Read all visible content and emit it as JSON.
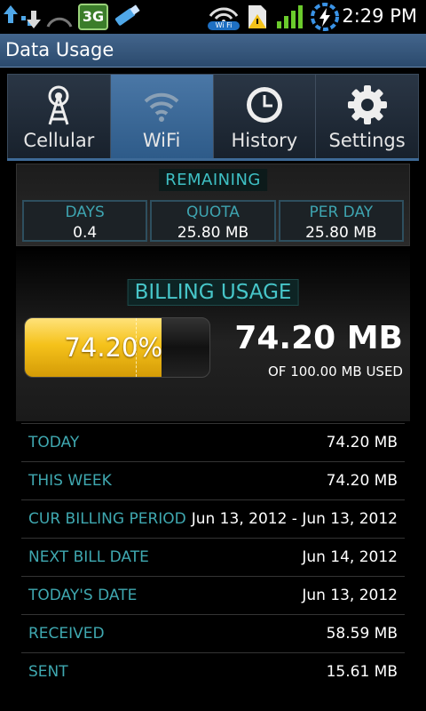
{
  "status_bar": {
    "time": "2:29 PM",
    "icons": [
      "upload-download-icon",
      "signal-arc-icon",
      "3g-badge-icon",
      "usb-icon",
      "wifi-icon",
      "sim-warning-icon",
      "cell-signal-bars-icon",
      "power-icon"
    ],
    "badge_3g": "3G",
    "wifi_label": "Wi Fi"
  },
  "header": {
    "title": "Data Usage"
  },
  "tabs": [
    {
      "label": "Cellular",
      "icon": "antenna-icon",
      "active": false
    },
    {
      "label": "WiFi",
      "icon": "wifi-icon",
      "active": true
    },
    {
      "label": "History",
      "icon": "clock-icon",
      "active": false
    },
    {
      "label": "Settings",
      "icon": "gear-icon",
      "active": false
    }
  ],
  "remaining": {
    "header": "REMAINING",
    "cells": [
      {
        "label": "DAYS",
        "value": "0.4"
      },
      {
        "label": "QUOTA",
        "value": "25.80 MB"
      },
      {
        "label": "PER DAY",
        "value": "25.80 MB"
      }
    ]
  },
  "billing": {
    "header": "BILLING USAGE",
    "percent_text": "74.20%",
    "percent_value": 0.742,
    "used_big": "74.20 MB",
    "used_small": "OF 100.00 MB USED"
  },
  "stats": [
    {
      "label": "TODAY",
      "value": "74.20 MB"
    },
    {
      "label": "THIS WEEK",
      "value": "74.20 MB"
    },
    {
      "label": "CUR BILLING PERIOD",
      "value": "Jun 13, 2012 - Jun 13, 2012"
    },
    {
      "label": "NEXT BILL DATE",
      "value": "Jun 14, 2012"
    },
    {
      "label": "TODAY'S DATE",
      "value": "Jun 13, 2012"
    },
    {
      "label": "RECEIVED",
      "value": "58.59 MB"
    },
    {
      "label": "SENT",
      "value": "15.61 MB"
    }
  ],
  "colors": {
    "accent_teal": "#3ec0c4",
    "tab_active": "#3a6896",
    "bar_fill": "#f5c21b"
  }
}
